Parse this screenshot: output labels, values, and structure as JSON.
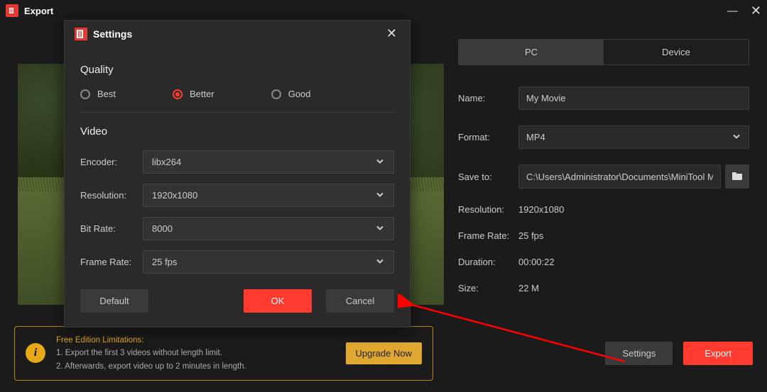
{
  "window": {
    "title": "Export"
  },
  "tabs": {
    "pc": "PC",
    "device": "Device"
  },
  "fields": {
    "name_label": "Name:",
    "name_value": "My Movie",
    "format_label": "Format:",
    "format_value": "MP4",
    "saveto_label": "Save to:",
    "saveto_value": "C:\\Users\\Administrator\\Documents\\MiniTool Movie",
    "resolution_label": "Resolution:",
    "resolution_value": "1920x1080",
    "framerate_label": "Frame Rate:",
    "framerate_value": "25 fps",
    "duration_label": "Duration:",
    "duration_value": "00:00:22",
    "size_label": "Size:",
    "size_value": "22 M"
  },
  "limitations": {
    "title": "Free Edition Limitations:",
    "line1": "1. Export the first 3 videos without length limit.",
    "line2": "2. Afterwards, export video up to 2 minutes in length.",
    "upgrade": "Upgrade Now"
  },
  "footer": {
    "settings": "Settings",
    "export": "Export"
  },
  "dialog": {
    "title": "Settings",
    "quality_heading": "Quality",
    "quality": {
      "best": "Best",
      "better": "Better",
      "good": "Good",
      "selected": "better"
    },
    "video_heading": "Video",
    "encoder_label": "Encoder:",
    "encoder_value": "libx264",
    "resolution_label": "Resolution:",
    "resolution_value": "1920x1080",
    "bitrate_label": "Bit Rate:",
    "bitrate_value": "8000",
    "framerate_label": "Frame Rate:",
    "framerate_value": "25 fps",
    "buttons": {
      "default": "Default",
      "ok": "OK",
      "cancel": "Cancel"
    }
  }
}
